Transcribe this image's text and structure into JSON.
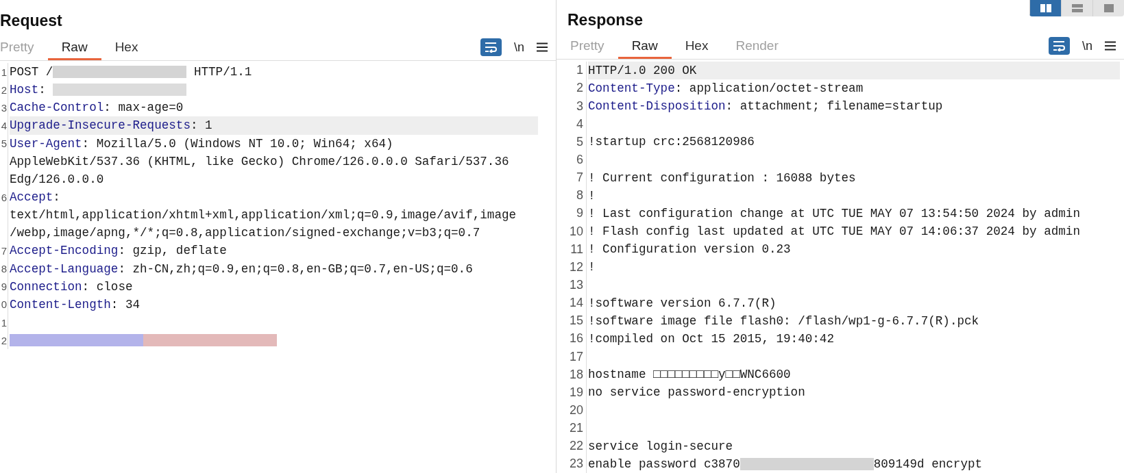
{
  "layout_toggle": [
    {
      "kind": "side-by-side",
      "selected": true
    },
    {
      "kind": "stacked",
      "selected": false
    },
    {
      "kind": "single",
      "selected": false
    }
  ],
  "request": {
    "title": "Request",
    "tabs": [
      {
        "label": "Pretty",
        "selected": false,
        "disabled": true
      },
      {
        "label": "Raw",
        "selected": true,
        "disabled": false
      },
      {
        "label": "Hex",
        "selected": false,
        "disabled": false
      }
    ],
    "toolbar": {
      "wrap_on": true,
      "newline_label": "\\n"
    },
    "lines": [
      {
        "number": "1",
        "highlighted": false,
        "segments": [
          {
            "kind": "text",
            "text": "POST /"
          },
          {
            "kind": "redacted",
            "color": "#d4d4d4"
          },
          {
            "kind": "text",
            "text": " HTTP/1.1"
          }
        ]
      },
      {
        "number": "2",
        "highlighted": false,
        "segments": [
          {
            "kind": "key",
            "text": "Host"
          },
          {
            "kind": "text",
            "text": ": "
          },
          {
            "kind": "redacted",
            "color": "#dcdcdc"
          }
        ]
      },
      {
        "number": "3",
        "highlighted": false,
        "segments": [
          {
            "kind": "key",
            "text": "Cache-Control"
          },
          {
            "kind": "text",
            "text": ": max-age=0"
          }
        ]
      },
      {
        "number": "4",
        "highlighted": true,
        "segments": [
          {
            "kind": "key",
            "text": "Upgrade-Insecure-Requests"
          },
          {
            "kind": "text",
            "text": ": 1"
          }
        ]
      },
      {
        "number": "5",
        "highlighted": false,
        "segments": [
          {
            "kind": "key",
            "text": "User-Agent"
          },
          {
            "kind": "text",
            "text": ": Mozilla/5.0 (Windows NT 10.0; Win64; x64)"
          }
        ]
      },
      {
        "highlighted": false,
        "segments": [
          {
            "kind": "text",
            "text": "AppleWebKit/537.36 (KHTML, like Gecko) Chrome/126.0.0.0 Safari/537.36"
          }
        ]
      },
      {
        "highlighted": false,
        "segments": [
          {
            "kind": "text",
            "text": "Edg/126.0.0.0"
          }
        ]
      },
      {
        "number": "6",
        "highlighted": false,
        "segments": [
          {
            "kind": "key",
            "text": "Accept"
          },
          {
            "kind": "text",
            "text": ":"
          }
        ]
      },
      {
        "highlighted": false,
        "segments": [
          {
            "kind": "text",
            "text": "text/html,application/xhtml+xml,application/xml;q=0.9,image/avif,image"
          }
        ]
      },
      {
        "highlighted": false,
        "segments": [
          {
            "kind": "text",
            "text": "/webp,image/apng,*/*;q=0.8,application/signed-exchange;v=b3;q=0.7"
          }
        ]
      },
      {
        "number": "7",
        "highlighted": false,
        "segments": [
          {
            "kind": "key",
            "text": "Accept-Encoding"
          },
          {
            "kind": "text",
            "text": ": gzip, deflate"
          }
        ]
      },
      {
        "number": "8",
        "highlighted": false,
        "segments": [
          {
            "kind": "key",
            "text": "Accept-Language"
          },
          {
            "kind": "text",
            "text": ": zh-CN,zh;q=0.9,en;q=0.8,en-GB;q=0.7,en-US;q=0.6"
          }
        ]
      },
      {
        "number": "9",
        "highlighted": false,
        "segments": [
          {
            "kind": "key",
            "text": "Connection"
          },
          {
            "kind": "text",
            "text": ": close"
          }
        ]
      },
      {
        "number": "0",
        "highlighted": false,
        "segments": [
          {
            "kind": "key",
            "text": "Content-Length"
          },
          {
            "kind": "text",
            "text": ": 34"
          }
        ]
      },
      {
        "number": "1",
        "highlighted": false
      },
      {
        "number": "2",
        "highlighted": false,
        "segments": [
          {
            "kind": "redacted",
            "color": "#b3b3ea"
          },
          {
            "kind": "redacted",
            "color": "#e3b9b9"
          }
        ]
      }
    ]
  },
  "response": {
    "title": "Response",
    "tabs": [
      {
        "label": "Pretty",
        "selected": false,
        "disabled": true
      },
      {
        "label": "Raw",
        "selected": true,
        "disabled": false
      },
      {
        "label": "Hex",
        "selected": false,
        "disabled": false
      },
      {
        "label": "Render",
        "selected": false,
        "disabled": true
      }
    ],
    "toolbar": {
      "wrap_on": true,
      "newline_label": "\\n"
    },
    "lines": [
      {
        "number": "1",
        "highlighted": true,
        "segments": [
          {
            "kind": "text",
            "text": "HTTP/1.0 200 OK"
          }
        ]
      },
      {
        "number": "2",
        "highlighted": false,
        "segments": [
          {
            "kind": "key",
            "text": "Content-Type"
          },
          {
            "kind": "text",
            "text": ": application/octet-stream"
          }
        ]
      },
      {
        "number": "3",
        "highlighted": false,
        "segments": [
          {
            "kind": "key",
            "text": "Content-Disposition"
          },
          {
            "kind": "text",
            "text": ": attachment; filename=startup"
          }
        ]
      },
      {
        "number": "4",
        "highlighted": false
      },
      {
        "number": "5",
        "highlighted": false,
        "segments": [
          {
            "kind": "text",
            "text": "!startup crc:2568120986"
          }
        ]
      },
      {
        "number": "6",
        "highlighted": false
      },
      {
        "number": "7",
        "highlighted": false,
        "segments": [
          {
            "kind": "text",
            "text": "! Current configuration : 16088 bytes"
          }
        ]
      },
      {
        "number": "8",
        "highlighted": false,
        "segments": [
          {
            "kind": "text",
            "text": "!"
          }
        ]
      },
      {
        "number": "9",
        "highlighted": false,
        "segments": [
          {
            "kind": "text",
            "text": "! Last configuration change at UTC TUE MAY 07 13:54:50 2024 by admin"
          }
        ]
      },
      {
        "number": "10",
        "highlighted": false,
        "segments": [
          {
            "kind": "text",
            "text": "! Flash config last updated at UTC TUE MAY 07 14:06:37 2024 by admin"
          }
        ]
      },
      {
        "number": "11",
        "highlighted": false,
        "segments": [
          {
            "kind": "text",
            "text": "! Configuration version 0.23"
          }
        ]
      },
      {
        "number": "12",
        "highlighted": false,
        "segments": [
          {
            "kind": "text",
            "text": "!"
          }
        ]
      },
      {
        "number": "13",
        "highlighted": false
      },
      {
        "number": "14",
        "highlighted": false,
        "segments": [
          {
            "kind": "text",
            "text": "!software version 6.7.7(R)"
          }
        ]
      },
      {
        "number": "15",
        "highlighted": false,
        "segments": [
          {
            "kind": "text",
            "text": "!software image file flash0: /flash/wp1-g-6.7.7(R).pck"
          }
        ]
      },
      {
        "number": "16",
        "highlighted": false,
        "segments": [
          {
            "kind": "text",
            "text": "!compiled on Oct 15 2015, 19:40:42"
          }
        ]
      },
      {
        "number": "17",
        "highlighted": false
      },
      {
        "number": "18",
        "highlighted": false,
        "segments": [
          {
            "kind": "text",
            "text": "hostname □□□□□□□□□у□□WNC6600"
          }
        ]
      },
      {
        "number": "19",
        "highlighted": false,
        "segments": [
          {
            "kind": "text",
            "text": "no service password-encryption"
          }
        ]
      },
      {
        "number": "20",
        "highlighted": false
      },
      {
        "number": "21",
        "highlighted": false
      },
      {
        "number": "22",
        "highlighted": false,
        "segments": [
          {
            "kind": "text",
            "text": "service login-secure"
          }
        ]
      },
      {
        "number": "23",
        "highlighted": false,
        "segments": [
          {
            "kind": "text",
            "text": "enable password c3870"
          },
          {
            "kind": "redacted",
            "color": "#d4d4d4"
          },
          {
            "kind": "text",
            "text": "809149d encrypt"
          }
        ]
      }
    ]
  }
}
